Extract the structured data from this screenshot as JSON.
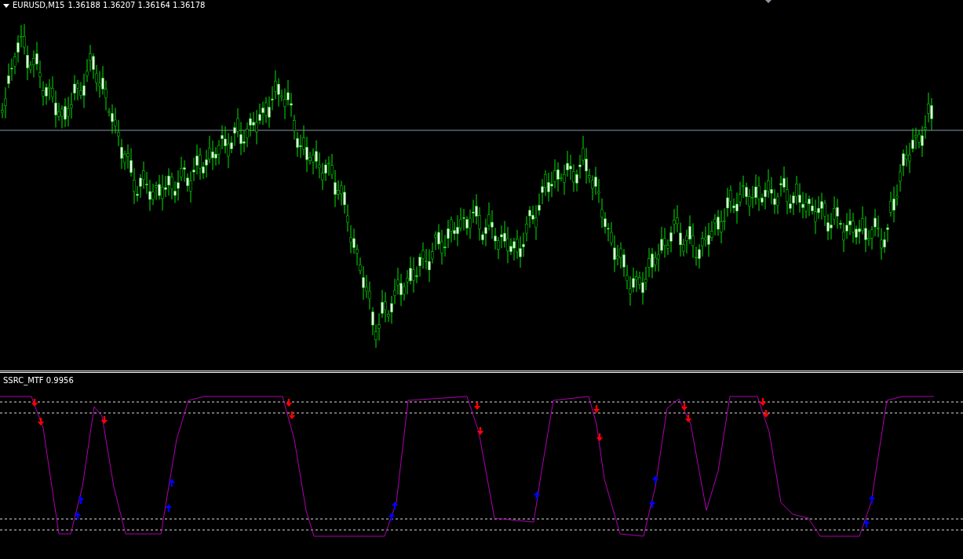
{
  "main_chart": {
    "symbol": "EURUSD,M15",
    "quote": "1.36188 1.36207 1.36164 1.36178"
  },
  "indicator": {
    "label": "SSRC_MTF 0.9956"
  }
}
